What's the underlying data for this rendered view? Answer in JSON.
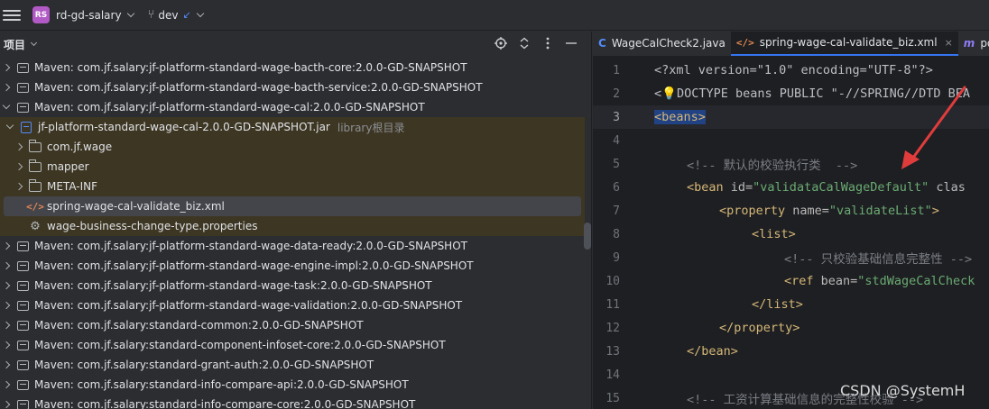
{
  "topbar": {
    "project_badge": "RS",
    "project_name": "rd-gd-salary",
    "branch_name": "dev",
    "branch_arrow": "↙"
  },
  "project_panel": {
    "title": "项目",
    "tools": [
      "locate-icon",
      "expand-collapse-icon",
      "more-icon",
      "minimize-icon"
    ]
  },
  "tree": [
    {
      "label": "Maven: com.jf.salary:jf-platform-standard-wage-bacth-core:2.0.0-GD-SNAPSHOT"
    },
    {
      "label": "Maven: com.jf.salary:jf-platform-standard-wage-bacth-service:2.0.0-GD-SNAPSHOT"
    },
    {
      "label": "Maven: com.jf.salary:jf-platform-standard-wage-cal:2.0.0-GD-SNAPSHOT"
    },
    {
      "label": "jf-platform-standard-wage-cal-2.0.0-GD-SNAPSHOT.jar",
      "hint": "library根目录"
    },
    {
      "label": "com.jf.wage"
    },
    {
      "label": "mapper"
    },
    {
      "label": "META-INF"
    },
    {
      "label": "spring-wage-cal-validate_biz.xml"
    },
    {
      "label": "wage-business-change-type.properties"
    },
    {
      "label": "Maven: com.jf.salary:jf-platform-standard-wage-data-ready:2.0.0-GD-SNAPSHOT"
    },
    {
      "label": "Maven: com.jf.salary:jf-platform-standard-wage-engine-impl:2.0.0-GD-SNAPSHOT"
    },
    {
      "label": "Maven: com.jf.salary:jf-platform-standard-wage-task:2.0.0-GD-SNAPSHOT"
    },
    {
      "label": "Maven: com.jf.salary:jf-platform-standard-wage-validation:2.0.0-GD-SNAPSHOT"
    },
    {
      "label": "Maven: com.jf.salary:standard-common:2.0.0-GD-SNAPSHOT"
    },
    {
      "label": "Maven: com.jf.salary:standard-component-infoset-core:2.0.0-GD-SNAPSHOT"
    },
    {
      "label": "Maven: com.jf.salary:standard-grant-auth:2.0.0-GD-SNAPSHOT"
    },
    {
      "label": "Maven: com.jf.salary:standard-info-compare-api:2.0.0-GD-SNAPSHOT"
    },
    {
      "label": "Maven: com.jf.salary:standard-info-compare-core:2.0.0-GD-SNAPSHOT"
    }
  ],
  "editor": {
    "tabs": [
      {
        "label": "WageCalCheck2.java",
        "icon": "C"
      },
      {
        "label": "spring-wage-cal-validate_biz.xml",
        "icon": "</>",
        "close": "×"
      },
      {
        "label": "pom.xm",
        "icon": "m"
      }
    ],
    "line_numbers": [
      "1",
      "2",
      "3",
      "4",
      "5",
      "6",
      "7",
      "8",
      "9",
      "10",
      "11",
      "12",
      "13",
      "14",
      "15"
    ],
    "code": {
      "l1": "<?xml version=\"1.0\" encoding=\"UTF-8\"?>",
      "l2_pre": "<",
      "l2_post": "DOCTYPE beans PUBLIC \"-//SPRING//DTD BEA",
      "l3": "<beans>",
      "l5": "<!-- 默认的校验执行类  -->",
      "l6_tag": "<bean ",
      "l6_attr": "id=",
      "l6_val": "\"validataCalWageDefault\"",
      "l6_rest": " clas",
      "l7_tag": "<property ",
      "l7_attr": "name=",
      "l7_val": "\"validateList\"",
      "l7_end": ">",
      "l8": "<list>",
      "l9": "<!-- 只校验基础信息完整性 -->",
      "l10_tag": "<ref ",
      "l10_attr": "bean=",
      "l10_val": "\"stdWageCalCheck",
      "l11": "</list>",
      "l12": "</property>",
      "l13": "</bean>",
      "l15": "<!-- 工资计算基础信息的完整性校验 -->"
    }
  },
  "watermark": "CSDN @SystemH",
  "colors": {
    "accent": "#3574f0",
    "annotation_arrow": "#e03c3c",
    "library_row": "#3d3623",
    "selection": "#214283"
  }
}
